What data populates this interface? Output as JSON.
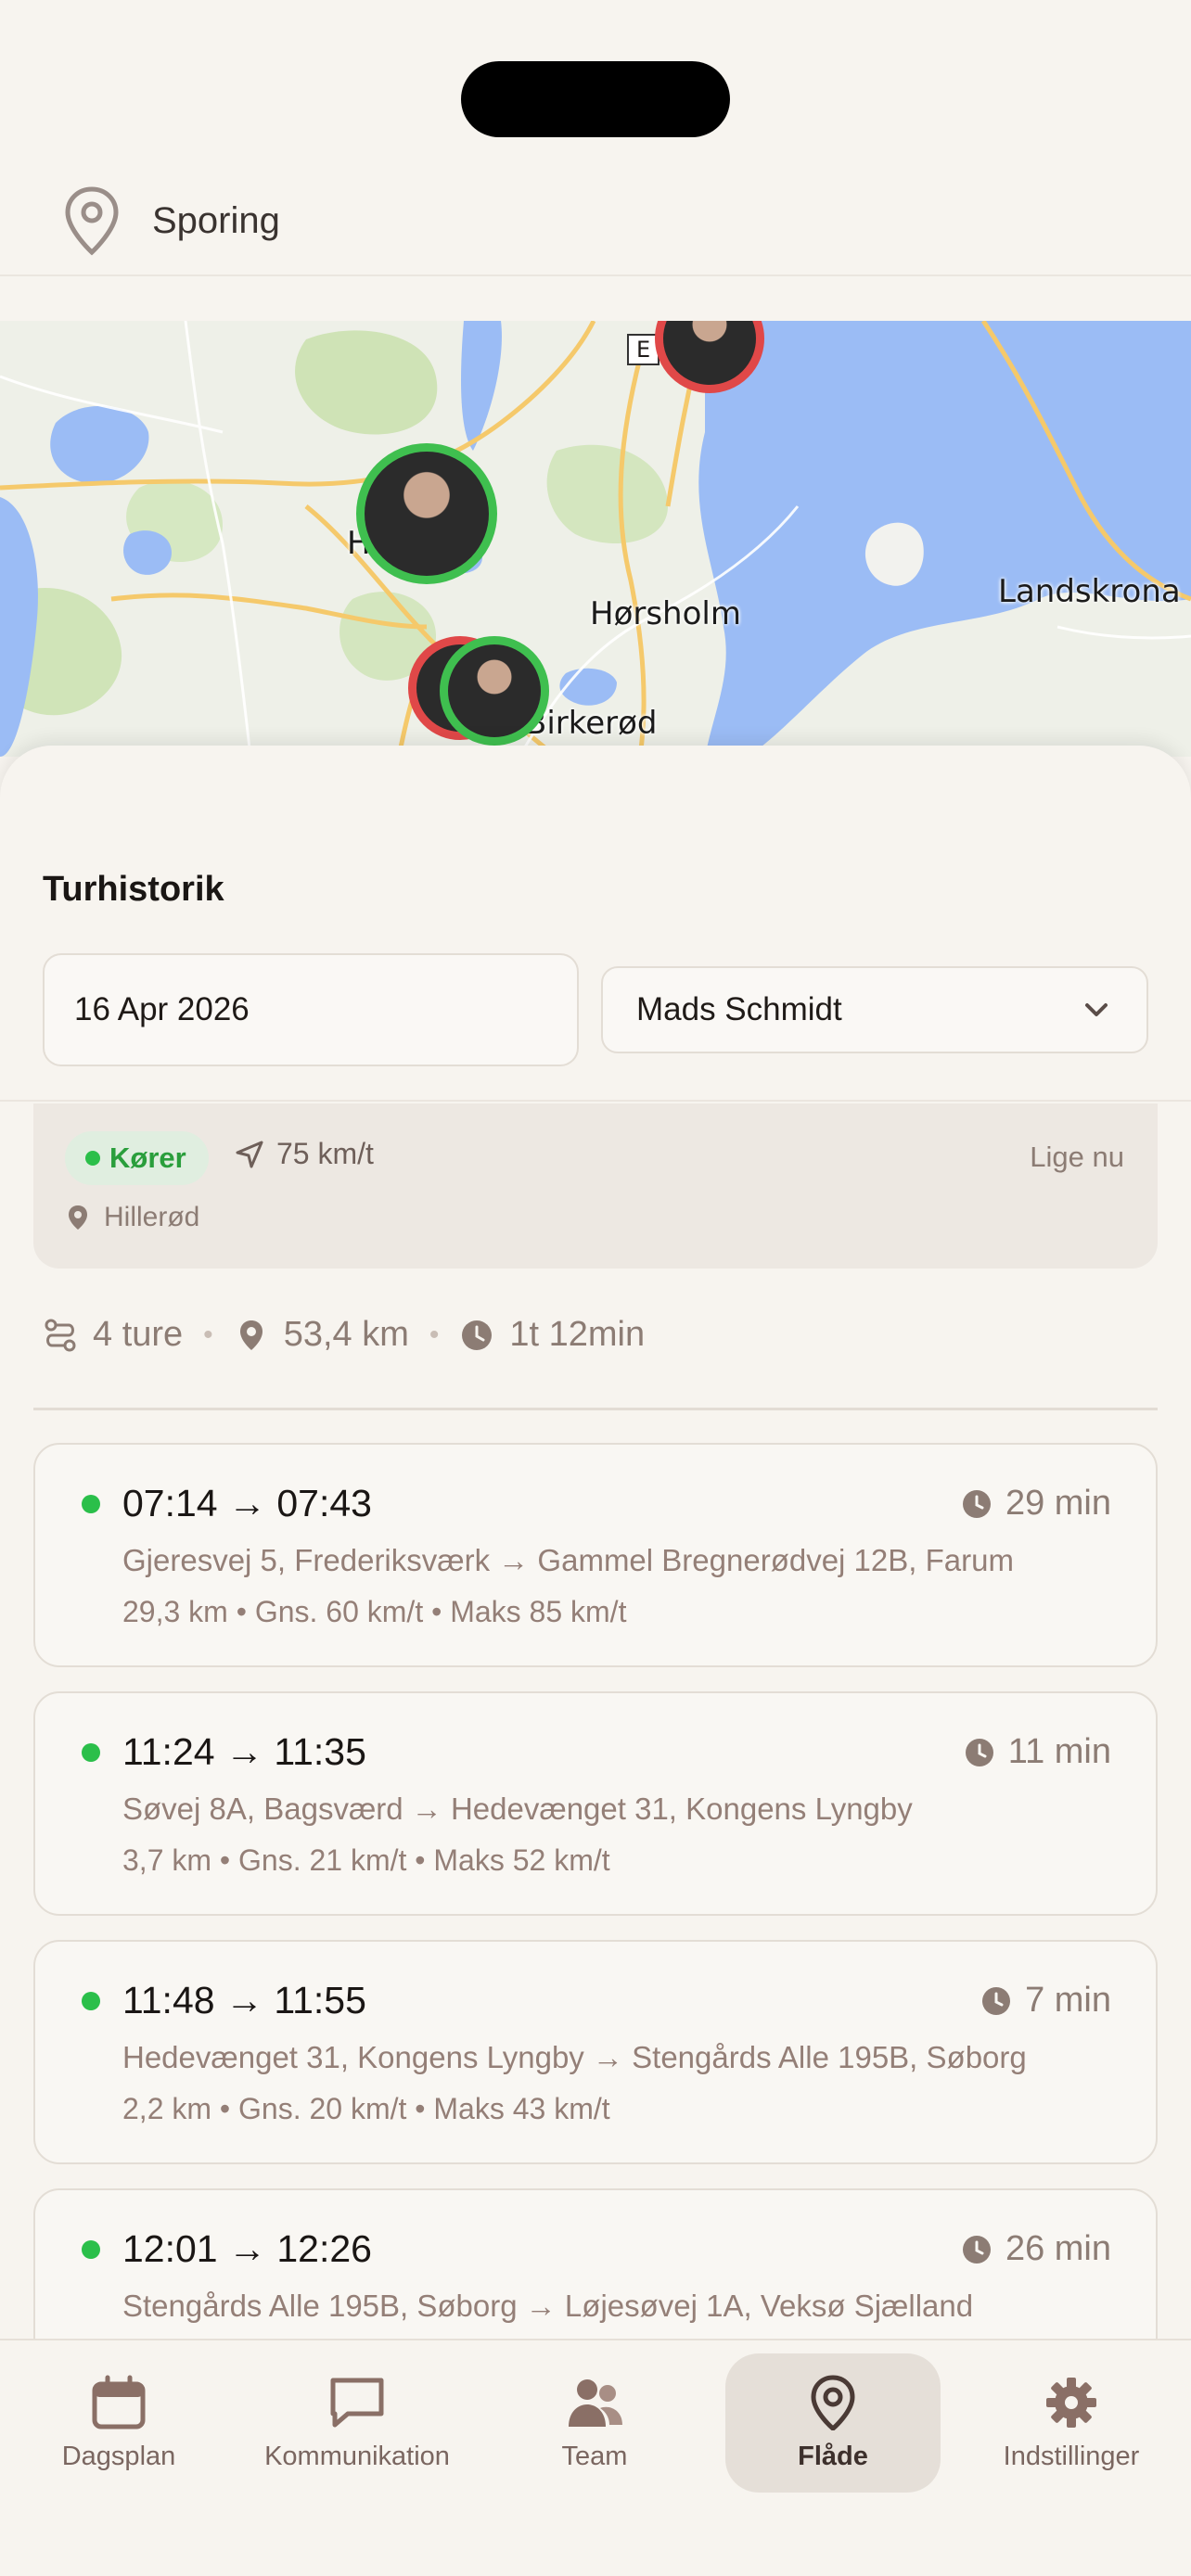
{
  "header": {
    "title": "Sporing",
    "icon": "location-pin-icon"
  },
  "map": {
    "labels": [
      "Hørsholm",
      "Landskrona",
      "Birkerød",
      "H"
    ],
    "road_shield": "E"
  },
  "sheet": {
    "title": "Turhistorik",
    "date_value": "16 Apr 2026",
    "driver_value": "Mads Schmidt"
  },
  "status": {
    "badge": "Kører",
    "speed": "75 km/t",
    "time": "Lige nu",
    "location": "Hillerød"
  },
  "summary": {
    "trips": "4 ture",
    "distance": "53,4 km",
    "duration": "1t 12min"
  },
  "trips": [
    {
      "time": "07:14 → 07:43",
      "duration": "29 min",
      "route": "Gjeresvej 5, Frederiksværk → Gammel Bregnerødvej 12B, Farum",
      "meta": "29,3 km • Gns. 60 km/t • Maks 85 km/t"
    },
    {
      "time": "11:24 → 11:35",
      "duration": "11 min",
      "route": "Søvej 8A, Bagsværd → Hedevænget 31, Kongens Lyngby",
      "meta": "3,7 km • Gns. 21 km/t • Maks 52 km/t"
    },
    {
      "time": "11:48 → 11:55",
      "duration": "7 min",
      "route": "Hedevænget 31, Kongens Lyngby → Stengårds Alle 195B, Søborg",
      "meta": "2,2 km • Gns. 20 km/t • Maks 43 km/t"
    },
    {
      "time": "12:01 → 12:26",
      "duration": "26 min",
      "route": "Stengårds Alle 195B, Søborg → Løjesøvej 1A, Veksø Sjælland",
      "meta": ""
    }
  ],
  "nav": [
    {
      "label": "Dagsplan",
      "icon": "calendar-icon"
    },
    {
      "label": "Kommunikation",
      "icon": "chat-bubble-icon"
    },
    {
      "label": "Team",
      "icon": "team-icon"
    },
    {
      "label": "Flåde",
      "icon": "location-pin-icon",
      "active": true
    },
    {
      "label": "Indstillinger",
      "icon": "gear-icon"
    }
  ],
  "colors": {
    "accent_green": "#2bbf4a",
    "accent_red": "#e04848",
    "background": "#f7f4ef",
    "muted_text": "#8c7c74"
  }
}
